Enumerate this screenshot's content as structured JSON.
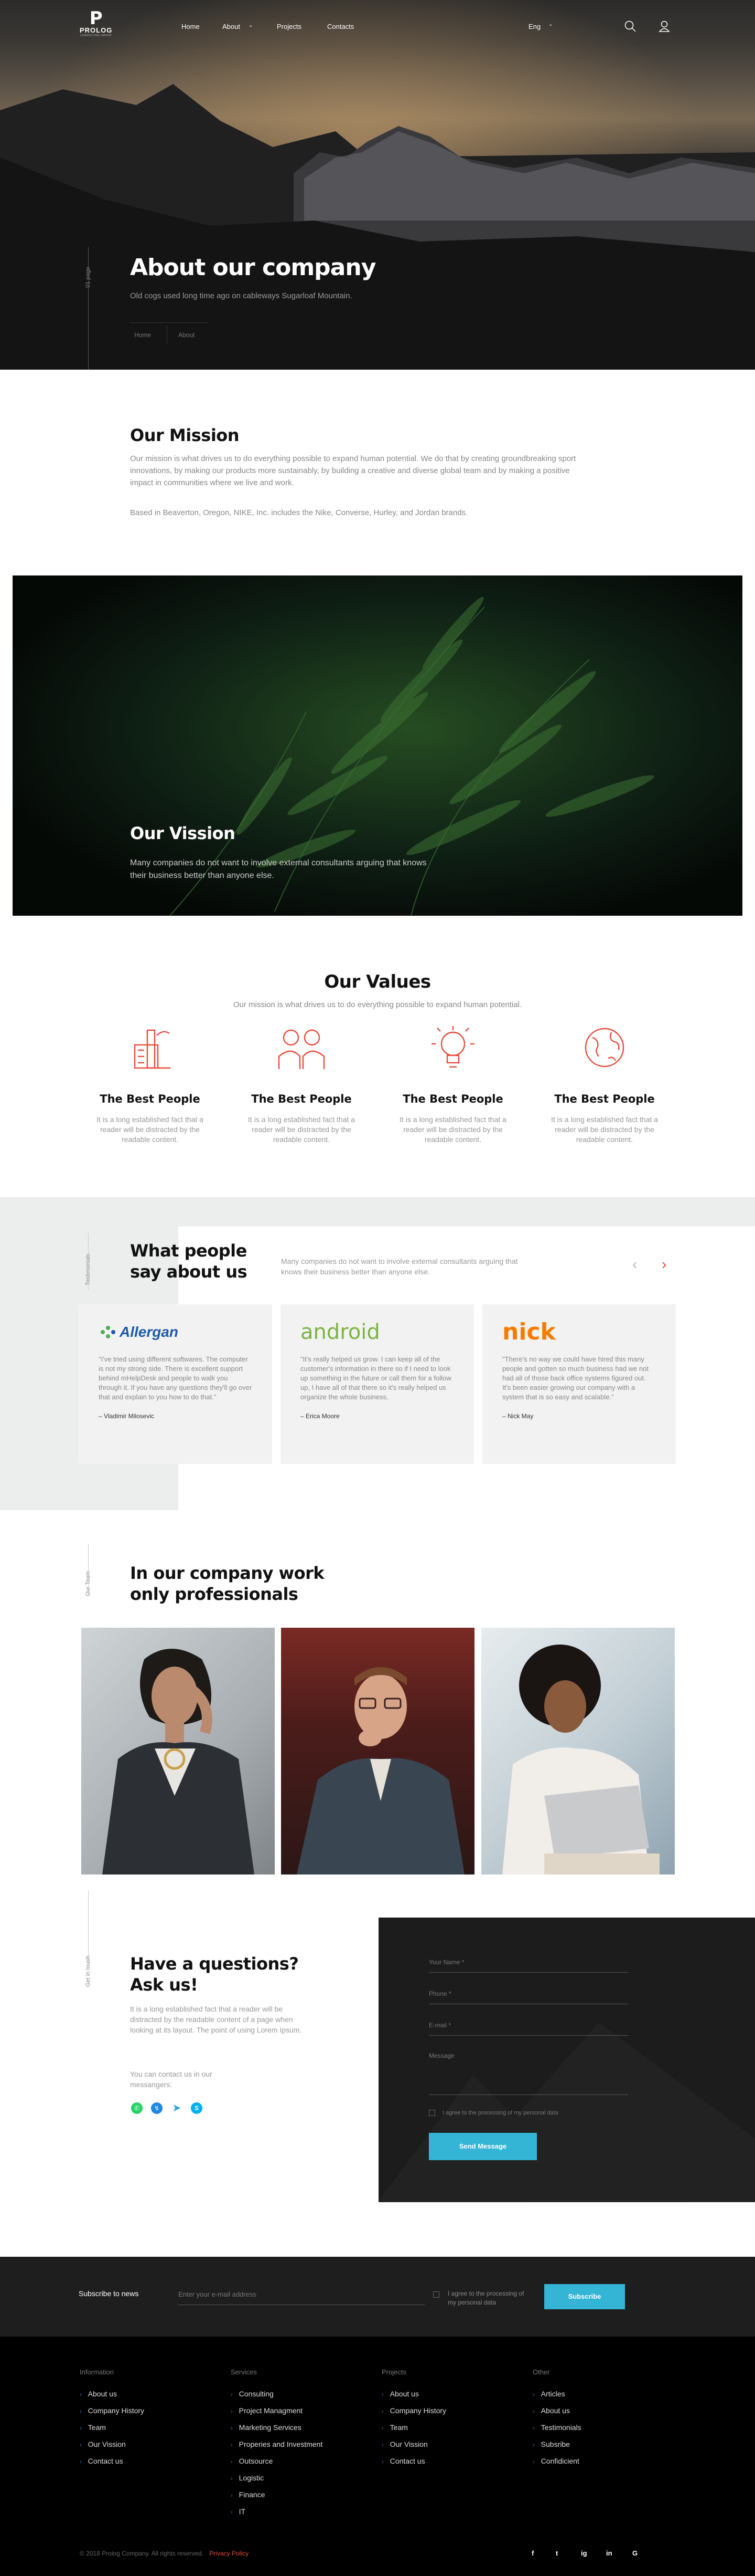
{
  "header": {
    "logo_mark": "P",
    "logo_name": "PROLOG",
    "logo_tag": "CONSULTING GROUP",
    "nav": [
      "Home",
      "About",
      "Projects",
      "Contacts"
    ],
    "lang": "Eng"
  },
  "hero": {
    "side_label": "01 page",
    "title": "About our company",
    "subtitle": "Old cogs used long time ago on cableways Sugarloaf Mountain.",
    "breadcrumb": [
      "Home",
      "About"
    ]
  },
  "mission": {
    "title": "Our Mission",
    "text1": "Our mission is what drives us to do everything possible to expand human potential. We do that by creating groundbreaking sport innovations, by making our products more sustainably, by building a creative and diverse global team and by making a positive impact in communities where we live and work.",
    "text2": "Based in Beaverton, Oregon, NIKE, Inc. includes the Nike, Converse, Hurley, and Jordan brands."
  },
  "vision": {
    "title": "Our Vission",
    "text": "Many companies do not want to involve external consultants arguing that knows their business better than anyone else."
  },
  "values": {
    "title": "Our Values",
    "subtitle": "Our mission is what drives us to do everything possible to expand human potential.",
    "items": [
      {
        "icon": "factory-icon",
        "title": "The Best People",
        "text": "It is a long established fact that a reader will be distracted by the readable content."
      },
      {
        "icon": "team-icon",
        "title": "The Best People",
        "text": "It is a long established fact that a reader will be distracted by the readable content."
      },
      {
        "icon": "lightbulb-icon",
        "title": "The Best People",
        "text": "It is a long established fact that a reader will be distracted by the readable content."
      },
      {
        "icon": "globe-icon",
        "title": "The Best People",
        "text": "It is a long established fact that a reader will be distracted by the readable content."
      }
    ]
  },
  "testimonials": {
    "side_label": "Testimonials",
    "title_line1": "What people",
    "title_line2": "say about us",
    "intro": "Many companies do not want to involve external consultants arguing that knows their business better than anyone else.",
    "cards": [
      {
        "brand": "Allergan",
        "quote": "\"I've tried using different softwares. The computer is not my strong side. There is excellent support behind mHelpDesk and people to walk you through it. If you have any questions they'll go over that and explain to you how to do that.\"",
        "author": "– Vladimir Milosevic"
      },
      {
        "brand": "android",
        "quote": "\"It's really helped us grow. I can keep all of the customer's information in there so if I need to look up something in the future or call them for a follow up, I have all of that there so it's really helped us organize the whole business.",
        "author": "– Erica Moore"
      },
      {
        "brand": "nick",
        "quote": "\"There's no way we could have hired this many people and gotten so much business had we not had all of those back office systems figured out. It's been easier growing our company with a system that is so easy and scalable.\"",
        "author": "– Nick May"
      }
    ]
  },
  "team": {
    "side_label": "Our Team",
    "title_line1": "In our company work",
    "title_line2": "only professionals"
  },
  "contact": {
    "side_label": "Get in touch",
    "title_line1": "Have a questions?",
    "title_line2": "Ask us!",
    "text": "It is a long established fact that a reader will be distracted by the readable content of a page when looking at its layout. The point of using Lorem Ipsum.",
    "messengers_label": "You can contact us in our messangers:",
    "messengers": [
      "whatsapp-icon",
      "messenger-icon",
      "telegram-icon",
      "skype-icon"
    ],
    "form": {
      "name": "Your Name *",
      "phone": "Phone *",
      "email": "E-mail *",
      "message": "Message",
      "agree": "I agree to the processing of my personal data",
      "submit": "Send Message"
    }
  },
  "subscribe": {
    "label": "Subscribe to news",
    "placeholder": "Enter your e-mail address",
    "agree": "I agree to the processing of my personal data",
    "button": "Subscribe"
  },
  "footer": {
    "columns": [
      {
        "title": "Information",
        "items": [
          "About us",
          "Company History",
          "Team",
          "Our Vission",
          "Contact us"
        ]
      },
      {
        "title": "Services",
        "items": [
          "Consulting",
          "Project Managment",
          "Marketing Services",
          "Properies and Investment",
          "Outsource",
          "Logistic",
          "Finance",
          "IT"
        ]
      },
      {
        "title": "Projects",
        "items": [
          "About us",
          "Company History",
          "Team",
          "Our Vission",
          "Contact us"
        ]
      },
      {
        "title": "Other",
        "items": [
          "Articles",
          "About us",
          "Testimonials",
          "Subsribe",
          "Confidicient"
        ]
      }
    ],
    "copyright": "© 2018 Prolog Company. All rights reserved.",
    "privacy": "Privacy Policy",
    "social": [
      "f",
      "t",
      "ig",
      "in",
      "G"
    ]
  },
  "colors": {
    "accent": "#e74c3c",
    "primary": "#35b5d6"
  }
}
